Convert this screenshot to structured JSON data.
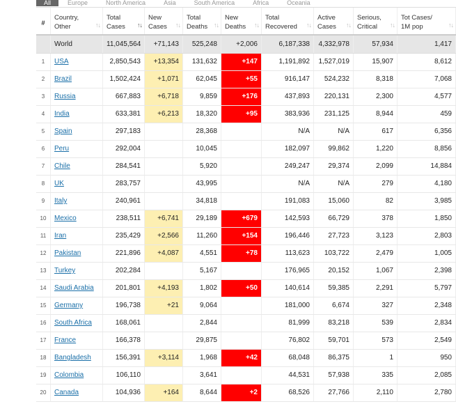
{
  "tabs": [
    "All",
    "Europe",
    "North America",
    "Asia",
    "South America",
    "Africa",
    "Oceania"
  ],
  "headers": {
    "num": "#",
    "country": [
      "Country,",
      "Other"
    ],
    "total_cases": [
      "Total",
      "Cases"
    ],
    "new_cases": [
      "New",
      "Cases"
    ],
    "total_deaths": [
      "Total",
      "Deaths"
    ],
    "new_deaths": [
      "New",
      "Deaths"
    ],
    "total_recovered": [
      "Total",
      "Recovered"
    ],
    "active_cases": [
      "Active",
      "Cases"
    ],
    "serious": [
      "Serious,",
      "Critical"
    ],
    "tot_cases_1m": [
      "Tot Cases/",
      "1M pop"
    ]
  },
  "world": {
    "country": "World",
    "total_cases": "11,045,564",
    "new_cases": "+71,143",
    "total_deaths": "525,248",
    "new_deaths": "+2,006",
    "total_recovered": "6,187,338",
    "active_cases": "4,332,978",
    "serious": "57,934",
    "per_million": "1,417"
  },
  "rows": [
    {
      "idx": "1",
      "country": "USA",
      "total_cases": "2,850,543",
      "new_cases": "+13,354",
      "total_deaths": "131,632",
      "new_deaths": "+147",
      "total_recovered": "1,191,892",
      "active_cases": "1,527,019",
      "serious": "15,907",
      "per_million": "8,612"
    },
    {
      "idx": "2",
      "country": "Brazil",
      "total_cases": "1,502,424",
      "new_cases": "+1,071",
      "total_deaths": "62,045",
      "new_deaths": "+55",
      "total_recovered": "916,147",
      "active_cases": "524,232",
      "serious": "8,318",
      "per_million": "7,068"
    },
    {
      "idx": "3",
      "country": "Russia",
      "total_cases": "667,883",
      "new_cases": "+6,718",
      "total_deaths": "9,859",
      "new_deaths": "+176",
      "total_recovered": "437,893",
      "active_cases": "220,131",
      "serious": "2,300",
      "per_million": "4,577"
    },
    {
      "idx": "4",
      "country": "India",
      "total_cases": "633,381",
      "new_cases": "+6,213",
      "total_deaths": "18,320",
      "new_deaths": "+95",
      "total_recovered": "383,936",
      "active_cases": "231,125",
      "serious": "8,944",
      "per_million": "459"
    },
    {
      "idx": "5",
      "country": "Spain",
      "total_cases": "297,183",
      "new_cases": "",
      "total_deaths": "28,368",
      "new_deaths": "",
      "total_recovered": "N/A",
      "active_cases": "N/A",
      "serious": "617",
      "per_million": "6,356"
    },
    {
      "idx": "6",
      "country": "Peru",
      "total_cases": "292,004",
      "new_cases": "",
      "total_deaths": "10,045",
      "new_deaths": "",
      "total_recovered": "182,097",
      "active_cases": "99,862",
      "serious": "1,220",
      "per_million": "8,856"
    },
    {
      "idx": "7",
      "country": "Chile",
      "total_cases": "284,541",
      "new_cases": "",
      "total_deaths": "5,920",
      "new_deaths": "",
      "total_recovered": "249,247",
      "active_cases": "29,374",
      "serious": "2,099",
      "per_million": "14,884"
    },
    {
      "idx": "8",
      "country": "UK",
      "total_cases": "283,757",
      "new_cases": "",
      "total_deaths": "43,995",
      "new_deaths": "",
      "total_recovered": "N/A",
      "active_cases": "N/A",
      "serious": "279",
      "per_million": "4,180"
    },
    {
      "idx": "9",
      "country": "Italy",
      "total_cases": "240,961",
      "new_cases": "",
      "total_deaths": "34,818",
      "new_deaths": "",
      "total_recovered": "191,083",
      "active_cases": "15,060",
      "serious": "82",
      "per_million": "3,985"
    },
    {
      "idx": "10",
      "country": "Mexico",
      "total_cases": "238,511",
      "new_cases": "+6,741",
      "total_deaths": "29,189",
      "new_deaths": "+679",
      "total_recovered": "142,593",
      "active_cases": "66,729",
      "serious": "378",
      "per_million": "1,850"
    },
    {
      "idx": "11",
      "country": "Iran",
      "total_cases": "235,429",
      "new_cases": "+2,566",
      "total_deaths": "11,260",
      "new_deaths": "+154",
      "total_recovered": "196,446",
      "active_cases": "27,723",
      "serious": "3,123",
      "per_million": "2,803"
    },
    {
      "idx": "12",
      "country": "Pakistan",
      "total_cases": "221,896",
      "new_cases": "+4,087",
      "total_deaths": "4,551",
      "new_deaths": "+78",
      "total_recovered": "113,623",
      "active_cases": "103,722",
      "serious": "2,479",
      "per_million": "1,005"
    },
    {
      "idx": "13",
      "country": "Turkey",
      "total_cases": "202,284",
      "new_cases": "",
      "total_deaths": "5,167",
      "new_deaths": "",
      "total_recovered": "176,965",
      "active_cases": "20,152",
      "serious": "1,067",
      "per_million": "2,398"
    },
    {
      "idx": "14",
      "country": "Saudi Arabia",
      "total_cases": "201,801",
      "new_cases": "+4,193",
      "total_deaths": "1,802",
      "new_deaths": "+50",
      "total_recovered": "140,614",
      "active_cases": "59,385",
      "serious": "2,291",
      "per_million": "5,797"
    },
    {
      "idx": "15",
      "country": "Germany",
      "total_cases": "196,738",
      "new_cases": "+21",
      "total_deaths": "9,064",
      "new_deaths": "",
      "total_recovered": "181,000",
      "active_cases": "6,674",
      "serious": "327",
      "per_million": "2,348"
    },
    {
      "idx": "16",
      "country": "South Africa",
      "total_cases": "168,061",
      "new_cases": "",
      "total_deaths": "2,844",
      "new_deaths": "",
      "total_recovered": "81,999",
      "active_cases": "83,218",
      "serious": "539",
      "per_million": "2,834"
    },
    {
      "idx": "17",
      "country": "France",
      "total_cases": "166,378",
      "new_cases": "",
      "total_deaths": "29,875",
      "new_deaths": "",
      "total_recovered": "76,802",
      "active_cases": "59,701",
      "serious": "573",
      "per_million": "2,549"
    },
    {
      "idx": "18",
      "country": "Bangladesh",
      "total_cases": "156,391",
      "new_cases": "+3,114",
      "total_deaths": "1,968",
      "new_deaths": "+42",
      "total_recovered": "68,048",
      "active_cases": "86,375",
      "serious": "1",
      "per_million": "950"
    },
    {
      "idx": "19",
      "country": "Colombia",
      "total_cases": "106,110",
      "new_cases": "",
      "total_deaths": "3,641",
      "new_deaths": "",
      "total_recovered": "44,531",
      "active_cases": "57,938",
      "serious": "335",
      "per_million": "2,085"
    },
    {
      "idx": "20",
      "country": "Canada",
      "total_cases": "104,936",
      "new_cases": "+164",
      "total_deaths": "8,644",
      "new_deaths": "+2",
      "total_recovered": "68,526",
      "active_cases": "27,766",
      "serious": "2,110",
      "per_million": "2,780"
    }
  ],
  "colors": {
    "new_cases_highlight": "#fdefb2",
    "new_deaths_highlight": "#ff0000",
    "world_row_bg": "#e6e6e6",
    "link": "#1a6fa8",
    "active_tab_bg": "#666666"
  },
  "icons": {
    "sort": "sort-arrows-icon"
  }
}
